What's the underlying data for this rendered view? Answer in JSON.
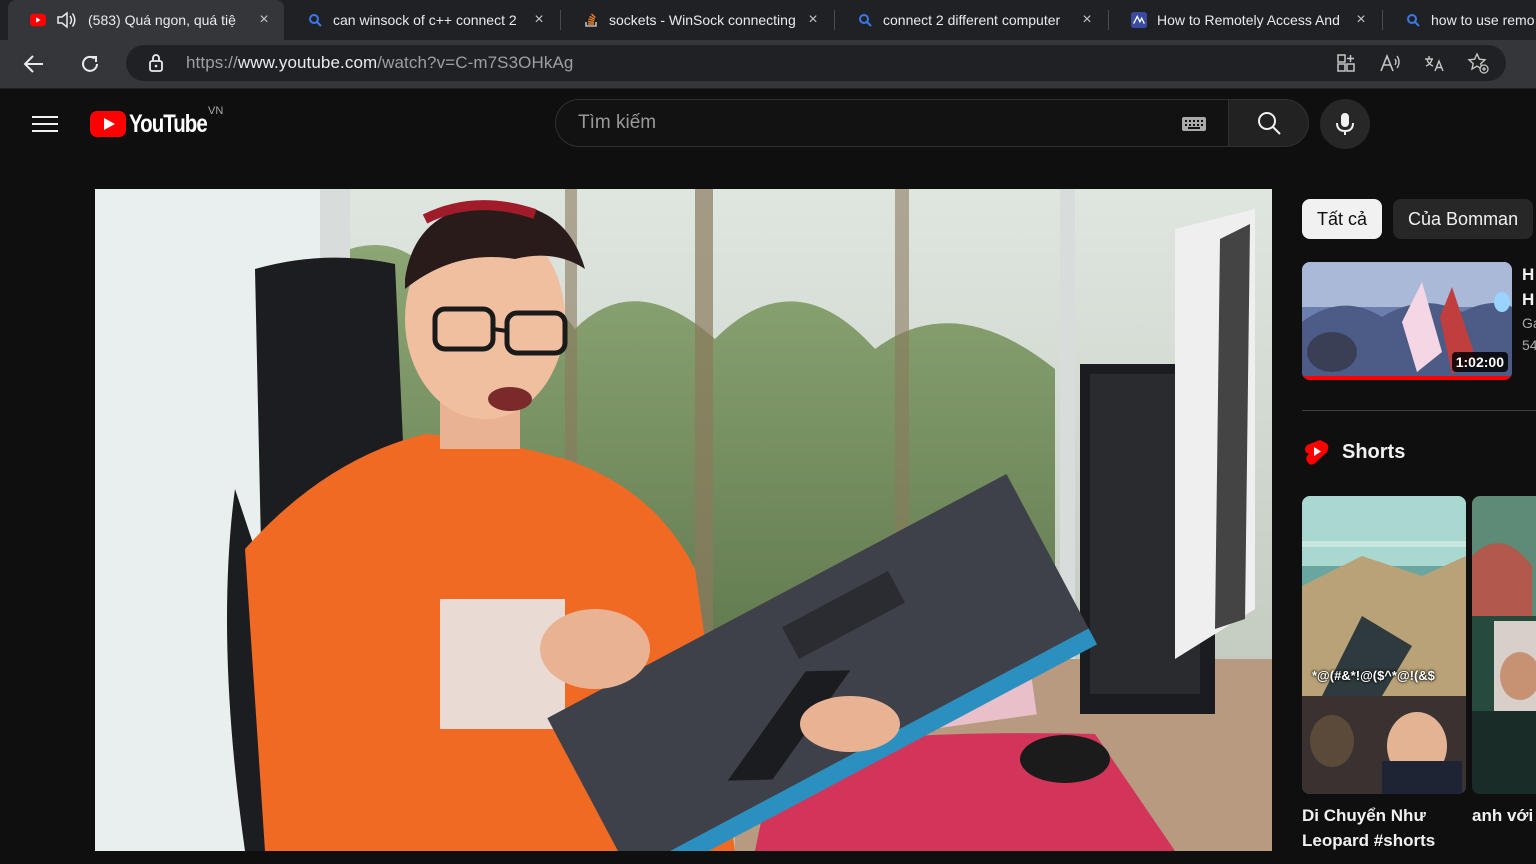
{
  "browser": {
    "tabs": [
      {
        "title": "(583) Quá ngon, quá tiệ",
        "favicon": "youtube-icon",
        "audio": true,
        "active": true
      },
      {
        "title": "can winsock of c++ connect 2",
        "favicon": "search-icon"
      },
      {
        "title": "sockets - WinSock connecting",
        "favicon": "stackoverflow-icon"
      },
      {
        "title": "connect 2 different computer",
        "favicon": "search-icon"
      },
      {
        "title": "How to Remotely Access And",
        "favicon": "site-icon"
      },
      {
        "title": "how to use remo",
        "favicon": "search-icon"
      }
    ],
    "close_glyph": "×",
    "url": {
      "scheme": "https://",
      "host": "www.youtube.com",
      "path": "/watch?v=C-m7S3OHkAg"
    }
  },
  "header": {
    "logo_text": "YouTube",
    "country_code": "VN",
    "search_placeholder": "Tìm kiếm"
  },
  "sidebar": {
    "chips": [
      {
        "label": "Tất cả",
        "selected": true
      },
      {
        "label": "Của Bomman",
        "selected": false
      }
    ],
    "recommended": {
      "duration": "1:02:00",
      "watched_fraction": 1.0,
      "title_fragment": "H",
      "title_fragment_2": "H",
      "channel_fragment": "Ga",
      "meta_fragment": "54"
    },
    "shorts_label": "Shorts",
    "shorts": [
      {
        "title": "Di Chuyển Như Leopard #shorts",
        "overlay_text": "*@(#&*!@($^*@!(&$"
      },
      {
        "title": "anh với Datmani"
      }
    ]
  },
  "colors": {
    "accent": "#ff0000",
    "background": "#0f0f0f",
    "chip_selected": "#f1f1f1"
  }
}
